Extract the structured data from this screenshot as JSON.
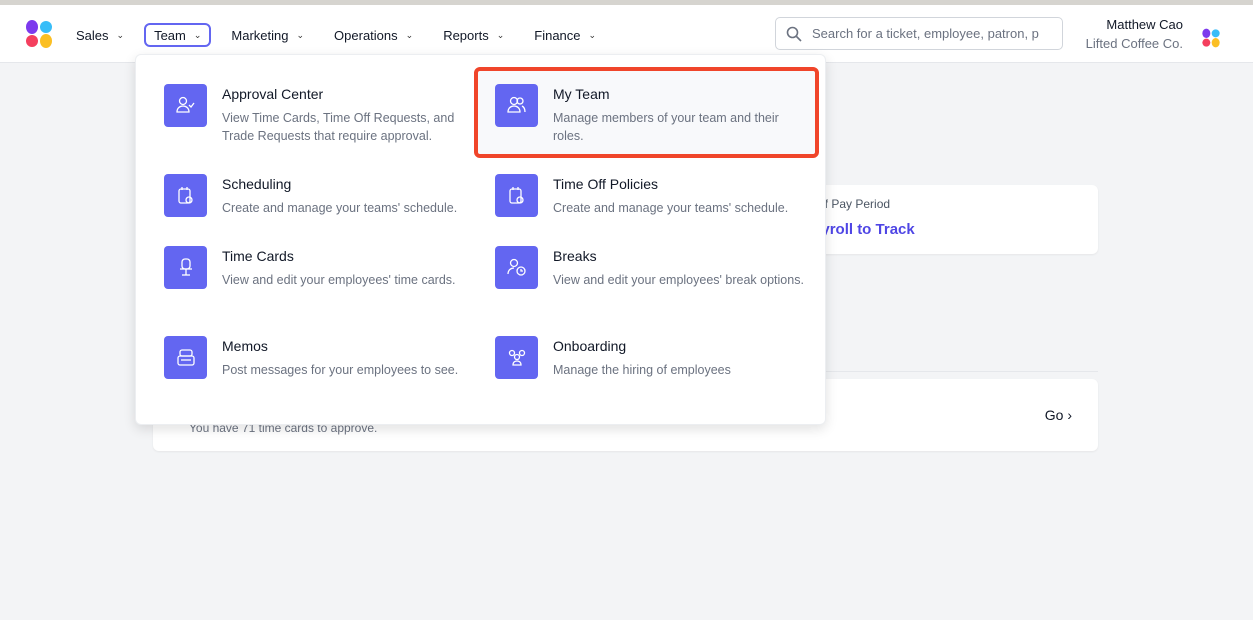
{
  "nav": {
    "items": [
      {
        "label": "Sales"
      },
      {
        "label": "Team",
        "active": true
      },
      {
        "label": "Marketing"
      },
      {
        "label": "Operations"
      },
      {
        "label": "Reports"
      },
      {
        "label": "Finance"
      }
    ]
  },
  "search": {
    "placeholder": "Search for a ticket, employee, patron, p"
  },
  "user": {
    "name": "Matthew Cao",
    "org": "Lifted Coffee Co."
  },
  "background": {
    "pay_period_label": "of Pay Period",
    "payroll_link": "Payroll to Track",
    "time_cards_text": "You have 71 time cards to approve.",
    "go_label": "Go ›"
  },
  "dropdown": {
    "items": [
      {
        "title": "Approval Center",
        "desc": "View Time Cards, Time Off Requests, and Trade Requests that require approval.",
        "icon": "user-check-icon"
      },
      {
        "title": "My Team",
        "desc": "Manage members of your team and their roles.",
        "icon": "users-icon",
        "highlighted": true
      },
      {
        "title": "Scheduling",
        "desc": "Create and manage your teams' schedule.",
        "icon": "calendar-icon"
      },
      {
        "title": "Time Off Policies",
        "desc": "Create and manage your teams' schedule.",
        "icon": "calendar-icon"
      },
      {
        "title": "Time Cards",
        "desc": "View and edit your employees' time cards.",
        "icon": "chair-icon"
      },
      {
        "title": "Breaks",
        "desc": "View and edit your employees' break options.",
        "icon": "user-clock-icon"
      },
      {
        "title": "Memos",
        "desc": "Post messages for your employees to see.",
        "icon": "memo-icon"
      },
      {
        "title": "Onboarding",
        "desc": "Manage the hiring of employees",
        "icon": "group-icon"
      }
    ]
  },
  "colors": {
    "accent": "#6366f1",
    "highlight": "#f0452a",
    "link": "#4f46e5"
  }
}
